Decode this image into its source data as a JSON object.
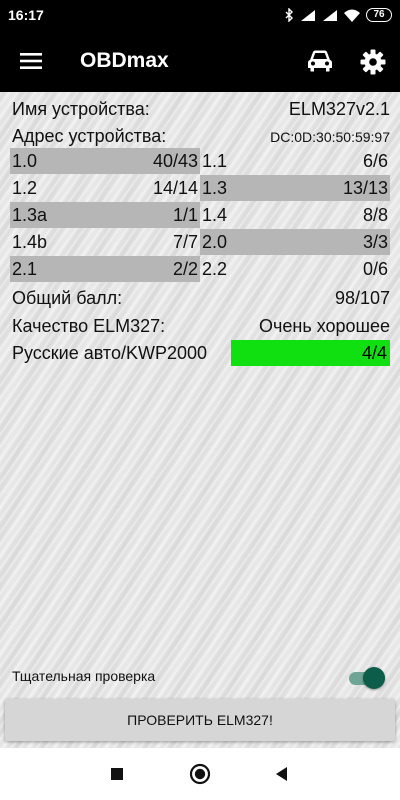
{
  "status_bar": {
    "time": "16:17",
    "battery": "76",
    "icons": [
      "bluetooth-icon",
      "signal-icon",
      "signal-icon",
      "wifi-icon",
      "battery-icon"
    ]
  },
  "app_bar": {
    "title": "OBDmax",
    "icons": [
      "menu-icon",
      "car-icon",
      "gear-icon"
    ]
  },
  "device": {
    "name_label": "Имя устройства:",
    "name_value": "ELM327v2.1",
    "address_label": "Адрес устройства:",
    "address_value": "DC:0D:30:50:59:97"
  },
  "tests": [
    {
      "id": "1.0",
      "score": "40/43"
    },
    {
      "id": "1.1",
      "score": "6/6"
    },
    {
      "id": "1.2",
      "score": "14/14"
    },
    {
      "id": "1.3",
      "score": "13/13"
    },
    {
      "id": "1.3a",
      "score": "1/1"
    },
    {
      "id": "1.4",
      "score": "8/8"
    },
    {
      "id": "1.4b",
      "score": "7/7"
    },
    {
      "id": "2.0",
      "score": "3/3"
    },
    {
      "id": "2.1",
      "score": "2/2"
    },
    {
      "id": "2.2",
      "score": "0/6"
    }
  ],
  "summary": {
    "total_label": "Общий балл:",
    "total_value": "98/107",
    "quality_label": "Качество ELM327:",
    "quality_value": "Очень хорошее",
    "kwp_label": "Русские авто/KWP2000",
    "kwp_value": "4/4"
  },
  "controls": {
    "thorough_label": "Тщательная проверка",
    "thorough_on": true,
    "check_button": "ПРОВЕРИТЬ ELM327!"
  },
  "colors": {
    "highlight_green": "#10e010",
    "toggle_thumb": "#0c5e4a",
    "row_shade": "#b6b6b6"
  },
  "nav_bar": {
    "icons": [
      "recent-apps-icon",
      "home-icon",
      "back-icon"
    ]
  }
}
